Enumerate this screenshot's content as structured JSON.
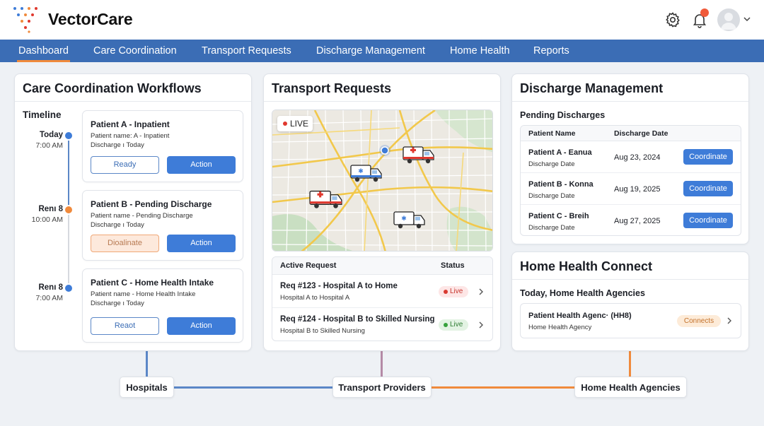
{
  "brand": {
    "name": "VectorCare"
  },
  "header": {
    "settings_icon": "gear-icon",
    "notifications_icon": "bell-icon",
    "notification_badge_color": "#f05a3a"
  },
  "nav": {
    "items": [
      {
        "label": "Dashboard",
        "active": true
      },
      {
        "label": "Care Coordination"
      },
      {
        "label": "Transport Requests"
      },
      {
        "label": "Discharge Management"
      },
      {
        "label": "Home Health"
      },
      {
        "label": "Reports"
      }
    ]
  },
  "care": {
    "title": "Care Coordination Workflows",
    "timeline_title": "Timeline",
    "entries": [
      {
        "label": "Today",
        "time": "7:00 AM",
        "dot_color": "#3e7cd8",
        "title": "Patient A - Inpatient",
        "line1": "Patient name: A - Inpatient",
        "line2": "Discharge ı Today",
        "secondary": "Ready",
        "primary": "Action"
      },
      {
        "label": "Renı 8",
        "time": "10:00 AM",
        "dot_color": "#f08a3c",
        "title": "Patient B - Pending Discharge",
        "line1": "Patient name - Pending Discharge",
        "line2": "Discharge ı Today",
        "secondary": "Dioalinate",
        "primary": "Action"
      },
      {
        "label": "Renı 8",
        "time": "7:00 AM",
        "dot_color": "#3e7cd8",
        "title": "Patient C - Home Health Intake",
        "line1": "Patient name - Home Health Intake",
        "line2": "Discharge ı Today",
        "secondary": "Reaot",
        "primary": "Action"
      }
    ]
  },
  "transport": {
    "title": "Transport Requests",
    "live_label": "LIVE",
    "table": {
      "col_request": "Active Request",
      "col_status": "Status",
      "rows": [
        {
          "title": "Req #123 - Hospital A to Home",
          "sub": "Hospital A to Hospital A",
          "status": "Live",
          "status_color": "#d93a31"
        },
        {
          "title": "Req #124 - Hospital B to Skilled Nursing",
          "sub": "Hospital B to Skilled Nursing",
          "status": "Live",
          "status_color": "#36a13b"
        }
      ]
    }
  },
  "discharge": {
    "title": "Discharge Management",
    "subtitle": "Pending Discharges",
    "col_name": "Patient Name",
    "col_date": "Discharge Date",
    "rows": [
      {
        "name": "Patient A - Eanua",
        "sub": "Discharge Date",
        "date": "Aug 23, 2024",
        "action": "Coordinate"
      },
      {
        "name": "Patient B - Konna",
        "sub": "Discharge Date",
        "date": "Aug 19, 2025",
        "action": "Coordinate"
      },
      {
        "name": "Patient C - Breih",
        "sub": "Discharge Date",
        "date": "Aug 27, 2025",
        "action": "Coordinate"
      }
    ]
  },
  "home_health": {
    "title": "Home Health Connect",
    "subtitle": "Today, Home Health Agencies",
    "agency_name": "Patient Health Agenc· (HH8)",
    "agency_sub": "Home Health Agency",
    "status": "Connects"
  },
  "network": {
    "nodes": [
      {
        "label": "Hospitals",
        "color": "#3e7cd8"
      },
      {
        "label": "Transport Providers",
        "color": "#9c6b8c"
      },
      {
        "label": "Home Health Agencies",
        "color": "#f08a3c"
      }
    ]
  }
}
